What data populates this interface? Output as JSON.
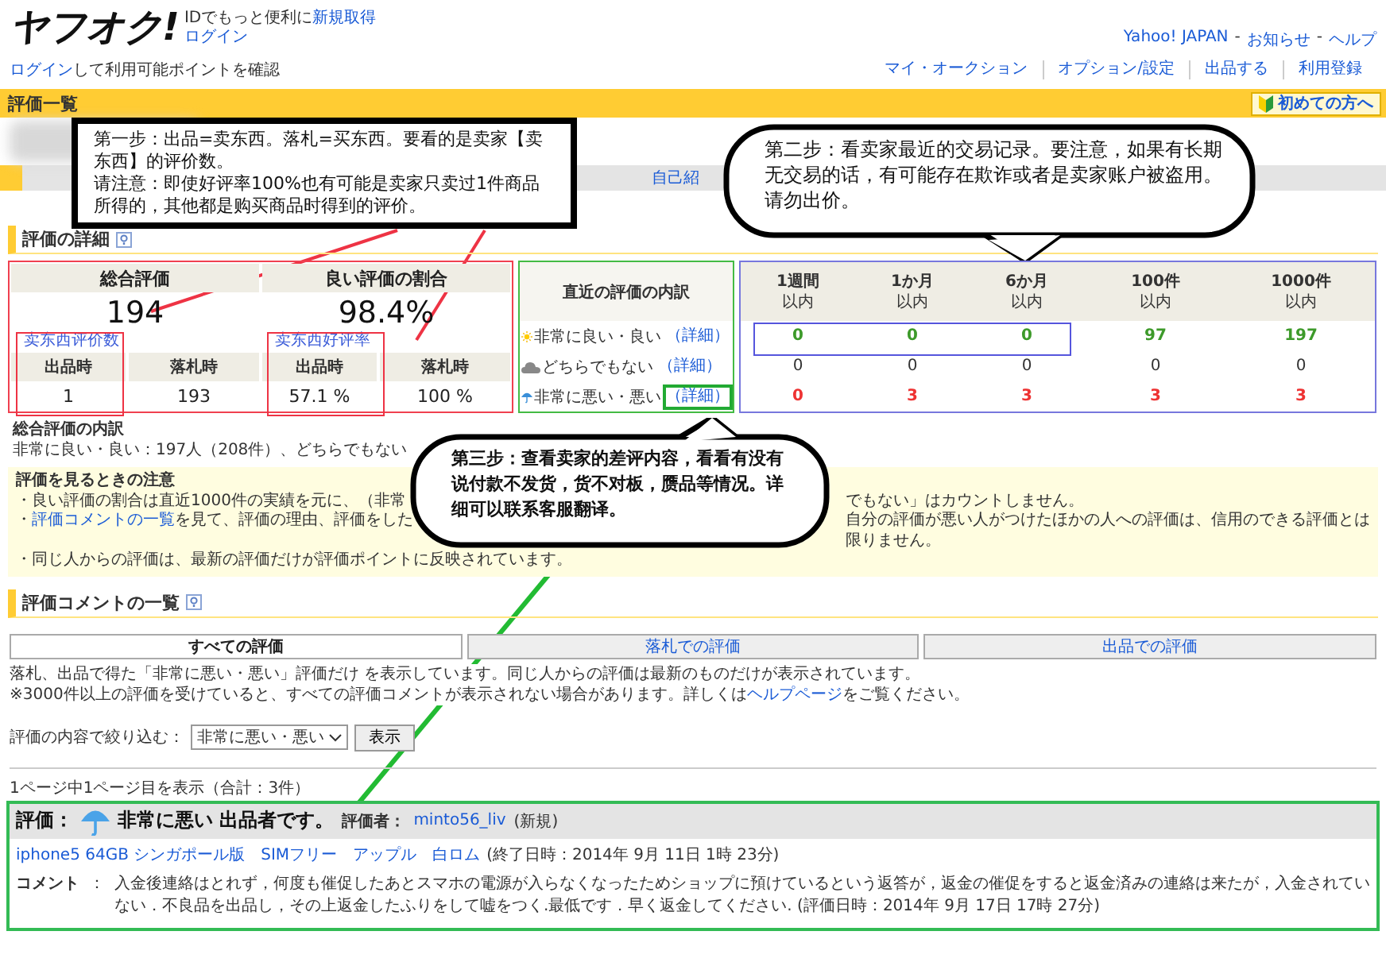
{
  "header": {
    "logo": "ヤフオク!",
    "promo": "IDでもっと便利に",
    "signup_link": "新規取得",
    "login_link": "ログイン",
    "global_links": [
      "Yahoo! JAPAN",
      "お知らせ",
      "ヘルプ"
    ],
    "separator": "-"
  },
  "points": {
    "login_link": "ログイン",
    "text": "して利用可能ポイントを確認"
  },
  "nav": [
    "マイ・オークション",
    "オプション/設定",
    "出品する",
    "利用登録"
  ],
  "title_bar": {
    "title": "評価一覧",
    "beginner_button": "初めての方へ"
  },
  "profile_link": "自己紹",
  "detail": {
    "title": "評価の詳細",
    "stats": [
      {
        "title": "総合評価",
        "value": "194",
        "annotation": "卖东西评价数",
        "columns": [
          {
            "label": "出品時",
            "value": "1"
          },
          {
            "label": "落札時",
            "value": "193"
          }
        ]
      },
      {
        "title": "良い評価の割合",
        "value": "98.4%",
        "annotation": "卖东西好评率",
        "columns": [
          {
            "label": "出品時",
            "value": "57.1 %"
          },
          {
            "label": "落札時",
            "value": "100 %"
          }
        ]
      }
    ],
    "recent": {
      "title": "直近の評価の内訳",
      "periods": [
        {
          "line1": "1週間",
          "line2": "以内"
        },
        {
          "line1": "1か月",
          "line2": "以内"
        },
        {
          "line1": "6か月",
          "line2": "以内"
        },
        {
          "line1": "100件",
          "line2": "以内"
        },
        {
          "line1": "1000件",
          "line2": "以内"
        }
      ],
      "rows": [
        {
          "kind": "good",
          "label": "非常に良い・良い",
          "link": "（詳細）",
          "highlighted": false,
          "values": [
            "0",
            "0",
            "0",
            "97",
            "197"
          ]
        },
        {
          "kind": "neutral",
          "label": "どちらでもない",
          "link": "（詳細）",
          "highlighted": false,
          "values": [
            "0",
            "0",
            "0",
            "0",
            "0"
          ]
        },
        {
          "kind": "bad",
          "label": "非常に悪い・悪い",
          "link": "（詳細）",
          "highlighted": true,
          "values": [
            "0",
            "3",
            "3",
            "3",
            "3"
          ]
        }
      ]
    }
  },
  "breakdown": {
    "title": "総合評価の内訳",
    "text": "非常に良い・良い：197人（208件）、どちらでもない"
  },
  "notice": {
    "title": "評価を見るときの注意",
    "items": [
      {
        "prefix": "・良い評価の割合は直近1000件の実績を元に、（非常",
        "tail": "でもない」はカウントしません。"
      },
      {
        "prefix": "・",
        "link": "評価コメントの一覧",
        "text": "を見て、評価の理由、評価をした",
        "tail": "自分の評価が悪い人がつけたほかの人への評価は、信用のできる評価とは限りません。"
      },
      {
        "prefix": "・同じ人からの評価は、最新の評価だけが評価ポイントに反映されています。"
      }
    ]
  },
  "comments": {
    "title": "評価コメントの一覧",
    "tabs": [
      {
        "label": "すべての評価",
        "selected": true
      },
      {
        "label": "落札での評価",
        "selected": false
      },
      {
        "label": "出品での評価",
        "selected": false
      }
    ],
    "notes": [
      {
        "text": "落札、出品で得た「非常に悪い・悪い」評価だけ を表示しています。同じ人からの評価は最新のものだけが表示されています。"
      },
      {
        "text": "※3000件以上の評価を受けていると、すべての評価コメントが表示されない場合があります。詳しくは",
        "link": "ヘルプページ",
        "after": "をご覧ください。"
      }
    ],
    "filter": {
      "label": "評価の内容で絞り込む：",
      "value": "非常に悪い・悪い",
      "button": "表示"
    },
    "page_info": "1ページ中1ページ目を表示（合計：3件）",
    "entries": [
      {
        "label": "評価：",
        "kind": "bad",
        "rating": "非常に悪い 出品者です。",
        "rater_label": "評価者：",
        "rater": "minto56_liv",
        "rater_note": "(新規)",
        "item": "iphone5 64GB シンガポール版　SIMフリー　アップル　白ロム",
        "end_time": "(終了日時：2014年 9月 11日 1時 23分)",
        "comment_label": "コメント",
        "colon": "：",
        "comment": "入金後連絡はとれず，何度も催促したあとスマホの電源が入らなくなったためショップに預けているという返答が，返金の催促をすると返金済みの連絡は来たが，入金されていない．不良品を出品し，その上返金したふりをして嘘をつく.最低です．早く返金してください. (評価日時：2014年 9月 17日 17時 27分)"
      }
    ]
  },
  "annotations": [
    {
      "kind": "box",
      "paragraphs": [
        "第一步：出品=卖东西。落札=买东西。要看的是卖家【卖东西】的评价数。",
        "请注意：即使好评率100%也有可能是卖家只卖过1件商品所得的，其他都是购买商品时得到的评价。"
      ]
    },
    {
      "kind": "bubble",
      "bold": false,
      "text": "第二步：看卖家最近的交易记录。要注意，如果有长期无交易的话，有可能存在欺诈或者是卖家账户被盗用。请勿出价。"
    },
    {
      "kind": "bubble",
      "bold": true,
      "text": "第三步：查看卖家的差评内容，看看有没有说付款不发货，货不对板，赝品等情况。详细可以联系客服翻译。"
    }
  ]
}
